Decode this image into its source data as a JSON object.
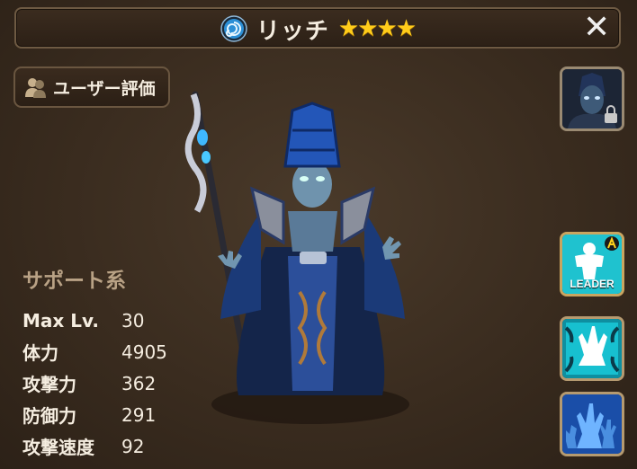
{
  "header": {
    "monster_name": "リッチ",
    "stars": "★★★★",
    "element_icon": "wind-element-icon",
    "close_icon": "close-icon"
  },
  "review_button": {
    "label": "ユーザー評価",
    "icon": "users-icon"
  },
  "side_buttons": {
    "awaken": {
      "icon": "awakened-portrait-lock-icon"
    },
    "leader": {
      "label": "LEADER",
      "icon": "leader-skill-icon"
    },
    "skill1": {
      "icon": "skill-hand-glow-icon"
    },
    "skill2": {
      "icon": "skill-hands-icon"
    }
  },
  "stats": {
    "type": "サポート系",
    "rows": [
      {
        "key": "Max Lv.",
        "value": "30"
      },
      {
        "key": "体力",
        "value": "4905"
      },
      {
        "key": "攻撃力",
        "value": "362"
      },
      {
        "key": "防御力",
        "value": "291"
      },
      {
        "key": "攻撃速度",
        "value": "92"
      }
    ]
  },
  "colors": {
    "background": "#3a2c1f",
    "star": "#ffcc1a",
    "skill_cyan": "#19c9d9",
    "skill_blue": "#1f64c8"
  }
}
